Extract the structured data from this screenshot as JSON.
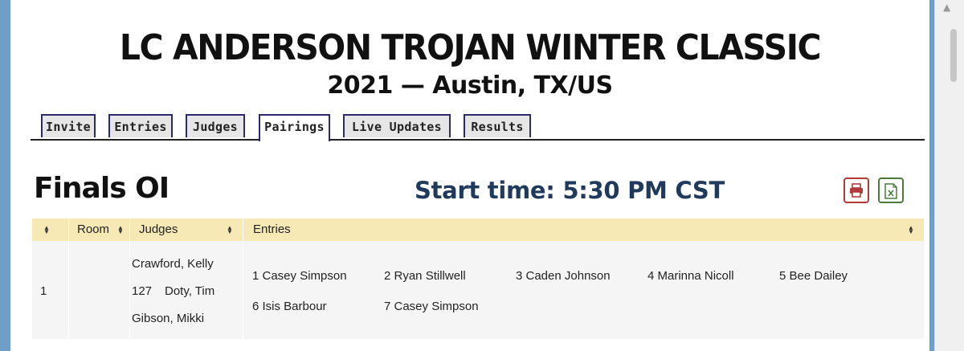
{
  "header": {
    "title": "LC ANDERSON TROJAN WINTER CLASSIC",
    "subtitle": "2021 — Austin, TX/US"
  },
  "tabs": [
    {
      "label": "Invite"
    },
    {
      "label": "Entries"
    },
    {
      "label": "Judges"
    },
    {
      "label": "Pairings",
      "active": true
    },
    {
      "label": "Live Updates"
    },
    {
      "label": "Results"
    }
  ],
  "round": {
    "name": "Finals OI",
    "start_time": "Start time: 5:30 PM CST"
  },
  "toolbar": {
    "print_icon": "printer-icon",
    "excel_icon": "excel-icon",
    "print_color": "#b33a3a",
    "excel_color": "#4c7a3a"
  },
  "table": {
    "columns": [
      "",
      "Room",
      "Judges",
      "Entries"
    ],
    "rows": [
      {
        "section": "1",
        "room": "",
        "judges": [
          "Crawford, Kelly",
          "127",
          "Doty, Tim",
          "Gibson, Mikki"
        ],
        "entries": [
          "1 Casey Simpson",
          "2 Ryan Stillwell",
          "3 Caden Johnson",
          "4 Marinna Nicoll",
          "5 Bee Dailey",
          "6 Isis Barbour",
          "7 Casey Simpson"
        ]
      }
    ]
  },
  "colors": {
    "header_row": "#f7e9b5",
    "tab_border": "#2d2a6b",
    "start_time": "#1f3a5c"
  }
}
